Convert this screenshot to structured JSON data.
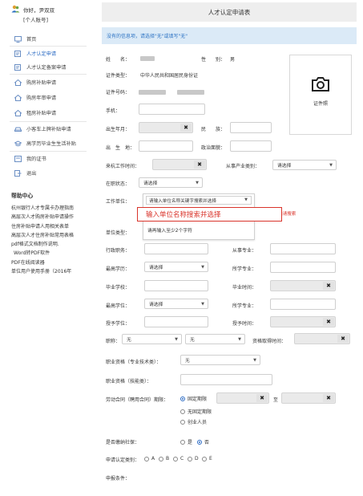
{
  "user": {
    "greeting": "你好，尹双双",
    "account_link": "[个人账号]"
  },
  "sidebar": {
    "items": [
      {
        "label": "首页",
        "icon": "monitor-icon"
      },
      {
        "label": "人才认定申请",
        "icon": "document-edit-icon",
        "active": true
      },
      {
        "label": "人才认定备案申请",
        "icon": "document-edit-icon"
      },
      {
        "label": "购房补贴申请",
        "icon": "house-icon"
      },
      {
        "label": "购房年审申请",
        "icon": "house-icon"
      },
      {
        "label": "租房补贴申请",
        "icon": "house-icon"
      },
      {
        "label": "小客车上牌补贴申请",
        "icon": "car-icon"
      },
      {
        "label": "高学历毕业生生活补贴",
        "icon": "graduation-cap-icon"
      },
      {
        "label": "我的证书",
        "icon": "certificate-icon"
      },
      {
        "label": "退出",
        "icon": "exit-icon"
      }
    ]
  },
  "help": {
    "title": "帮助中心",
    "links": [
      "杭州银行人才专属卡办理指南",
      "高层次人才购房补贴申请操作",
      "住房补贴申请人用相关表单",
      "高层次人才住房补贴常用表格",
      "pdf格式文档制作说明.",
      "Word转PDF软件",
      "PDF在线阅读器",
      "单位用户使用手册（2016年"
    ]
  },
  "main": {
    "title": "人才认定申请表",
    "notice": "没有的信息项，请选择\"无\"或填写\"无\"",
    "photo_caption": "证件照",
    "fields": {
      "name_label": "姓　　名：",
      "gender_label": "性　　别：",
      "gender_value": "男",
      "id_type_label": "证件类型：",
      "id_type_value": "中华人民共和国居民身份证",
      "id_no_label": "证件号码：",
      "phone_label": "手机：",
      "birth_label": "出生年月：",
      "ethnic_label": "民　　族：",
      "birthplace_label": "出　生　地：",
      "political_label": "政治面貌：",
      "arrive_label": "来杭工作时间：",
      "industry_label": "从事产业类别：",
      "industry_value": "请选择",
      "status_label": "在职状态：",
      "status_value": "请选择",
      "employer_label": "工作单位：",
      "employer_placeholder": "请输入单位名称关键字搜索并选择",
      "employer_hint": "请再输入至少2个字符",
      "callout_text": "输入单位名称搜索并选择",
      "red_hint": "搜索未本系统请搜索",
      "unit_type_label": "单位类型：",
      "admin_post_label": "行政职务：",
      "major_label": "从事专业：",
      "degree_label": "最高学历：",
      "degree_value": "请选择",
      "study_major_label": "所学专业：",
      "grad_school_label": "毕业学校：",
      "grad_time_label": "毕业时间：",
      "top_degree_label": "最高学位：",
      "top_degree_value": "请选择",
      "study_major2_label": "所学专业：",
      "degree_school_label": "授予学位：",
      "degree_time_label": "授予时间：",
      "title_label": "职称：",
      "title_value_1": "无",
      "title_value_2": "无",
      "title_time_label": "资格取得时间：",
      "qual_prof_label": "职业资格（专业技术类）：",
      "qual_prof_value": "无",
      "qual_skill_label": "职业资格（技能类）：",
      "contract_label": "劳动合同（聘用合同）期限：",
      "contract_options": [
        "固定期限",
        "无固定期限",
        "创业人员"
      ],
      "contract_to": "至",
      "social_label": "是否缴纳社保：",
      "social_yes": "是",
      "social_no": "否",
      "category_label": "申请认定类别：",
      "category_options": [
        "A",
        "B",
        "C",
        "D",
        "E"
      ],
      "conditions_label": "申报条件："
    }
  },
  "colors": {
    "accent": "#2e6dc4",
    "notice_bg": "#dbeaf7",
    "error": "#d9342b"
  }
}
